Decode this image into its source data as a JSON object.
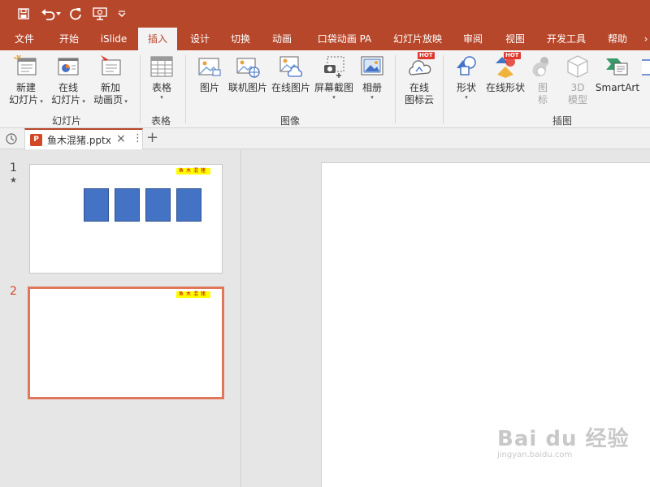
{
  "quick_access": {
    "save_icon": "save-icon",
    "undo_icon": "undo-icon",
    "redo_icon": "redo-icon",
    "present_icon": "present-from-beginning-icon",
    "customize_icon": "customize-toolbar-icon"
  },
  "menu": {
    "tabs": [
      "文件",
      "开始",
      "iSlide",
      "插入",
      "设计",
      "切换",
      "动画",
      "口袋动画 PA",
      "幻灯片放映",
      "审阅",
      "视图",
      "开发工具",
      "帮助"
    ],
    "active_tab": "插入"
  },
  "ribbon": {
    "groups": {
      "slides": {
        "label": "幻灯片",
        "new_slide": [
          "新建",
          "幻灯片"
        ],
        "online_slide": [
          "在线",
          "幻灯片"
        ],
        "add_animation_page": [
          "新加",
          "动画页"
        ]
      },
      "table": {
        "label": "表格",
        "table_button": "表格"
      },
      "image": {
        "label": "图像",
        "picture": "图片",
        "online_picture": "联机图片",
        "online_image": "在线图片",
        "screenshot": [
          "屏幕截图"
        ],
        "album": "相册"
      },
      "icon_cloud": {
        "online_icon": [
          "在线",
          "图标云"
        ],
        "hot_badge": "HOT"
      },
      "illustration": {
        "label": "插图",
        "shapes": "形状",
        "online_shapes": "在线形状",
        "online_shapes_badge": "HOT",
        "icons": [
          "图",
          "标"
        ],
        "model_3d": [
          "3D",
          "模型"
        ],
        "smartart": "SmartArt"
      }
    }
  },
  "file_tab": {
    "name": "鱼木混猪.pptx",
    "app_badge": "P"
  },
  "slides": [
    {
      "number": "1",
      "star": "★",
      "tag": "鱼木混猪",
      "rect_count": 4
    },
    {
      "number": "2",
      "tag": "鱼木混猪",
      "selected": true
    }
  ],
  "watermark": {
    "main": "Bai du 经验",
    "sub": "jingyan.baidu.com"
  },
  "colors": {
    "accent": "#b7472a",
    "shape_fill": "#4472c4",
    "tag_bg": "#ffff00",
    "selected_border": "#e0775a"
  }
}
